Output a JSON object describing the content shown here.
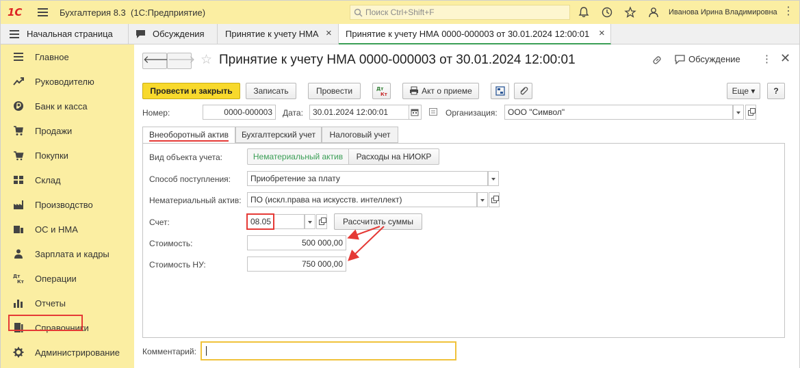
{
  "app": {
    "logo": "1С",
    "title": "Бухгалтерия 8.3",
    "subtitle": "(1С:Предприятие)",
    "search_placeholder": "Поиск Ctrl+Shift+F",
    "user": "Иванова Ирина Владимировна"
  },
  "open_tabs": [
    {
      "label": "Начальная страница"
    },
    {
      "label": "Обсуждения"
    },
    {
      "label": "Принятие к учету НМА"
    },
    {
      "label": "Принятие к учету НМА 0000-000003 от 30.01.2024 12:00:01"
    }
  ],
  "sidebar": {
    "items": [
      {
        "label": "Главное",
        "icon": "menu-icon"
      },
      {
        "label": "Руководителю",
        "icon": "trend-icon"
      },
      {
        "label": "Банк и касса",
        "icon": "ruble-icon"
      },
      {
        "label": "Продажи",
        "icon": "cart-icon"
      },
      {
        "label": "Покупки",
        "icon": "basket-icon"
      },
      {
        "label": "Склад",
        "icon": "warehouse-icon"
      },
      {
        "label": "Производство",
        "icon": "factory-icon"
      },
      {
        "label": "ОС и НМА",
        "icon": "assets-icon"
      },
      {
        "label": "Зарплата и кадры",
        "icon": "people-icon"
      },
      {
        "label": "Операции",
        "icon": "dt-kt-icon"
      },
      {
        "label": "Отчеты",
        "icon": "bar-chart-icon"
      },
      {
        "label": "Справочники",
        "icon": "book-icon"
      },
      {
        "label": "Администрирование",
        "icon": "gear-icon"
      }
    ]
  },
  "document": {
    "title": "Принятие к учету НМА 0000-000003 от 30.01.2024 12:00:01",
    "discussion_label": "Обсуждение"
  },
  "toolbar": {
    "post_close": "Провести и закрыть",
    "save": "Записать",
    "post": "Провести",
    "dtkt": "ДтКт",
    "act": "Акт о приеме",
    "more": "Еще",
    "help": "?"
  },
  "header_fields": {
    "number_label": "Номер:",
    "number": "0000-000003",
    "date_label": "Дата:",
    "date": "30.01.2024 12:00:01",
    "org_label": "Организация:",
    "org": "ООО \"Символ\""
  },
  "form_tabs": [
    {
      "label": "Внеоборотный актив"
    },
    {
      "label": "Бухгалтерский учет"
    },
    {
      "label": "Налоговый учет"
    }
  ],
  "form": {
    "object_type_label": "Вид объекта учета:",
    "object_type_options": [
      "Нематериальный актив",
      "Расходы на НИОКР"
    ],
    "receipt_method_label": "Способ поступления:",
    "receipt_method": "Приобретение за плату",
    "intangible_label": "Нематериальный актив:",
    "intangible": "ПО (искл.права на искусств. интеллект)",
    "account_label": "Счет:",
    "account": "08.05",
    "calc_button": "Рассчитать суммы",
    "cost_label": "Стоимость:",
    "cost": "500 000,00",
    "tax_cost_label": "Стоимость НУ:",
    "tax_cost": "750 000,00",
    "comment_label": "Комментарий:",
    "comment": ""
  },
  "colors": {
    "sidebar_bg": "#fbeea2",
    "primary_button": "#f8d92c",
    "highlight": "#e53935",
    "active_green": "#3a9e55"
  }
}
